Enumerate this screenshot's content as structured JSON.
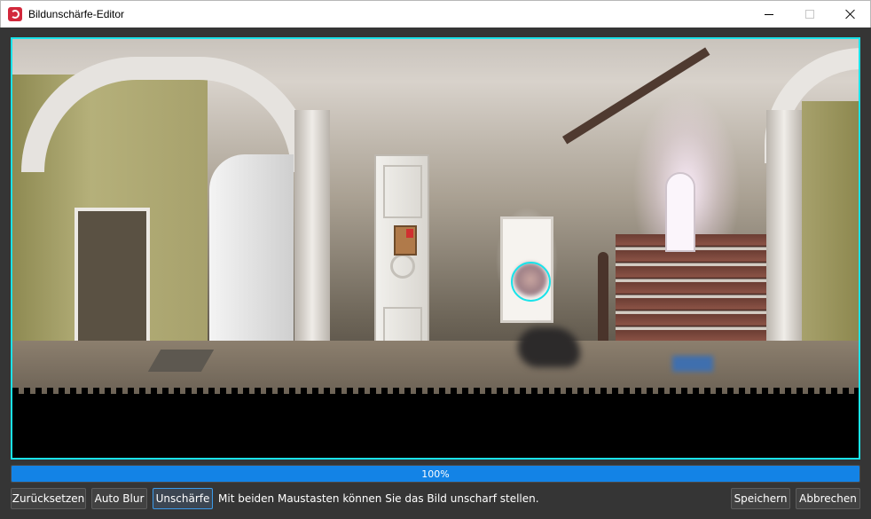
{
  "window": {
    "title": "Bildunschärfe-Editor",
    "app_icon": "rose-icon",
    "controls": [
      "minimize-icon",
      "maximize-icon",
      "close-icon"
    ]
  },
  "canvas": {
    "frame_color": "#19e3ea",
    "blur_cursor_color": "#19e3ea"
  },
  "progress": {
    "value": 1.0,
    "label": "100%",
    "fill_color": "#1383e6"
  },
  "toolbar": {
    "reset_label": "Zurücksetzen",
    "auto_blur_label": "Auto Blur",
    "blur_label": "Unschärfe",
    "hint_text": "Mit beiden Maustasten können Sie das Bild unscharf stellen.",
    "save_label": "Speichern",
    "cancel_label": "Abbrechen"
  },
  "colors": {
    "background": "#353535",
    "button": "#424242",
    "active_button_border": "#3b9bea"
  }
}
